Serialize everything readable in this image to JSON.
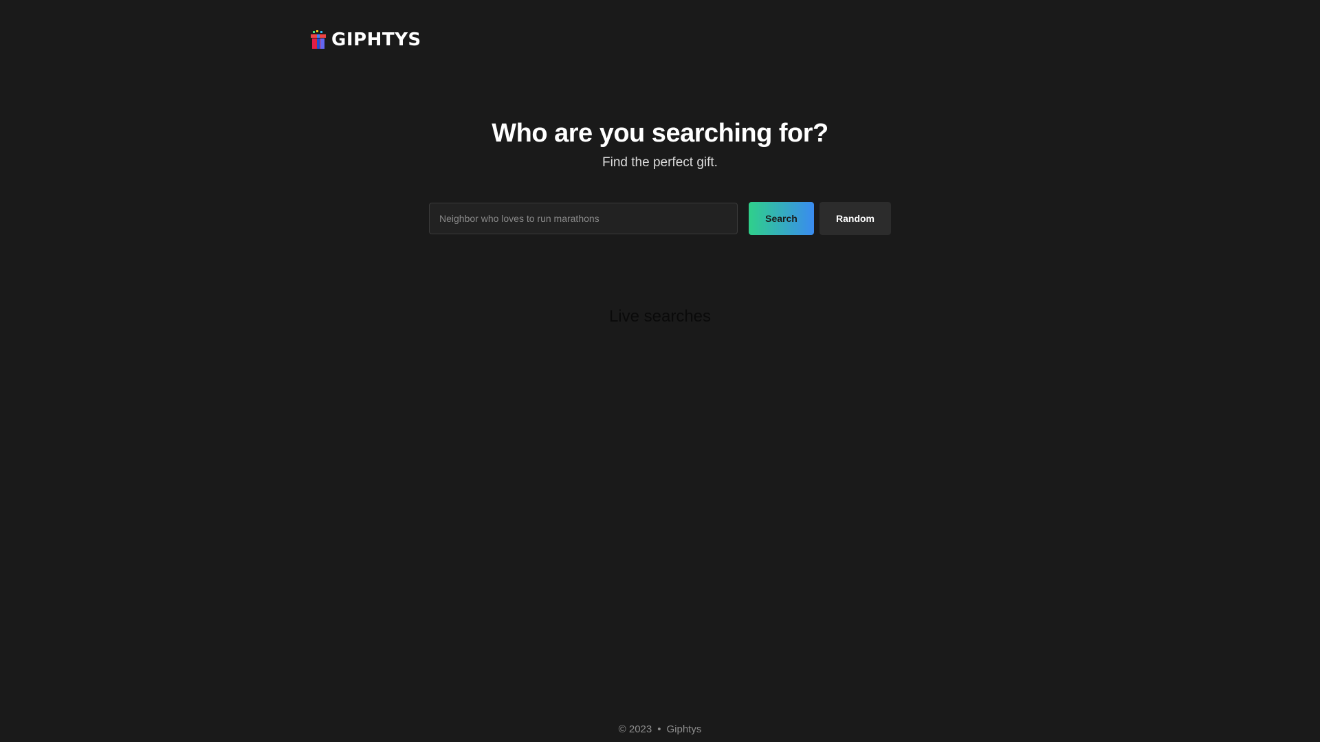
{
  "header": {
    "logo_text": "GIPHTYS",
    "logo_icon": "gift-icon"
  },
  "hero": {
    "title": "Who are you searching for?",
    "subtitle": "Find the perfect gift."
  },
  "search": {
    "placeholder": "Neighbor who loves to run marathons",
    "value": "",
    "search_label": "Search",
    "random_label": "Random"
  },
  "live": {
    "heading": "Live searches"
  },
  "footer": {
    "copyright": "© 2023",
    "separator": "•",
    "brand": "Giphtys"
  },
  "colors": {
    "background": "#1a1a1a",
    "search_gradient_start": "#2fd08a",
    "search_gradient_end": "#3a8bf0",
    "random_button": "#2c2c2c"
  }
}
